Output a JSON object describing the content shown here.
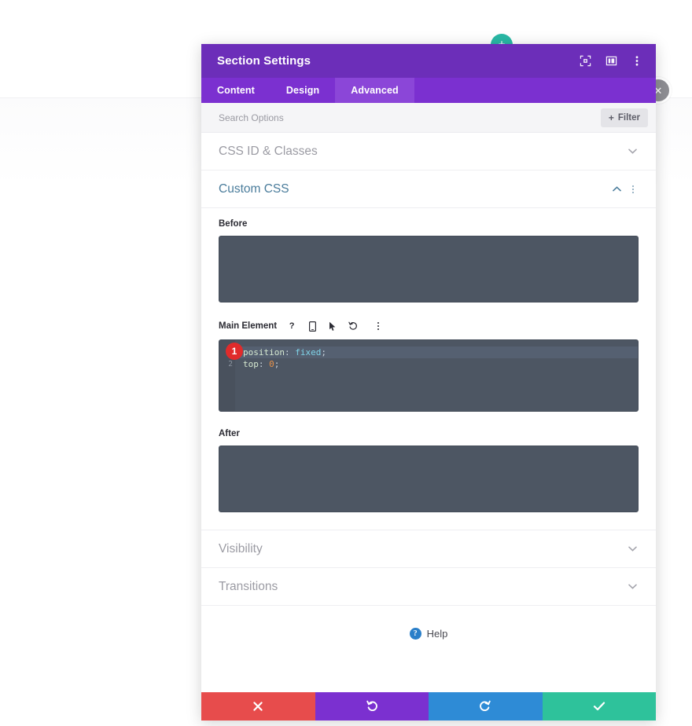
{
  "floating": {
    "add_button_label": "+",
    "add_button_color": "#29b8a5",
    "close_button_label": "✕",
    "close_button_color": "#8e8e93"
  },
  "modal": {
    "title": "Section Settings",
    "header_color": "#6c2eb9",
    "header_icons": [
      {
        "name": "fullscreen-icon"
      },
      {
        "name": "layout-columns-icon"
      },
      {
        "name": "more-vertical-icon"
      }
    ],
    "tabs": [
      {
        "label": "Content",
        "active": false
      },
      {
        "label": "Design",
        "active": false
      },
      {
        "label": "Advanced",
        "active": true
      }
    ],
    "search": {
      "placeholder": "Search Options",
      "value": "",
      "filter_label": "Filter",
      "filter_plus": "+"
    },
    "sections": [
      {
        "title": "CSS ID & Classes",
        "state": "collapsed",
        "chevron": "⌄"
      },
      {
        "title": "Custom CSS",
        "state": "expanded",
        "chevron": "⌃"
      },
      {
        "title": "Visibility",
        "state": "collapsed",
        "chevron": "⌄"
      },
      {
        "title": "Transitions",
        "state": "collapsed",
        "chevron": "⌄"
      }
    ],
    "custom_css": {
      "before_label": "Before",
      "before_value": "",
      "main_element_label": "Main Element",
      "main_element_icons": [
        {
          "name": "help-question-icon",
          "glyph": "?"
        },
        {
          "name": "mobile-device-icon"
        },
        {
          "name": "cursor-pointer-icon"
        },
        {
          "name": "reset-undo-icon"
        },
        {
          "name": "more-vertical-icon"
        }
      ],
      "after_label": "After",
      "after_value": "",
      "editor": {
        "badge": "1",
        "lines": [
          {
            "number": "1",
            "highlighted": true,
            "tokens": [
              {
                "text": "position",
                "type": "prop"
              },
              {
                "text": ":",
                "type": "punc"
              },
              {
                "text": " fixed",
                "type": "val"
              },
              {
                "text": ";",
                "type": "punc"
              }
            ]
          },
          {
            "number": "2",
            "highlighted": false,
            "tokens": [
              {
                "text": "top",
                "type": "prop"
              },
              {
                "text": ":",
                "type": "punc"
              },
              {
                "text": " 0",
                "type": "num"
              },
              {
                "text": ";",
                "type": "punc"
              }
            ]
          }
        ]
      }
    },
    "help": {
      "label": "Help",
      "icon_glyph": "?"
    },
    "footer_buttons": [
      {
        "name": "cancel-button",
        "glyph": "✖",
        "color": "#e74c4c"
      },
      {
        "name": "undo-button",
        "glyph": "↺",
        "color": "#7b30d0"
      },
      {
        "name": "redo-button",
        "glyph": "↻",
        "color": "#2e8bd6"
      },
      {
        "name": "save-button",
        "glyph": "✔",
        "color": "#2ec29b"
      }
    ]
  }
}
